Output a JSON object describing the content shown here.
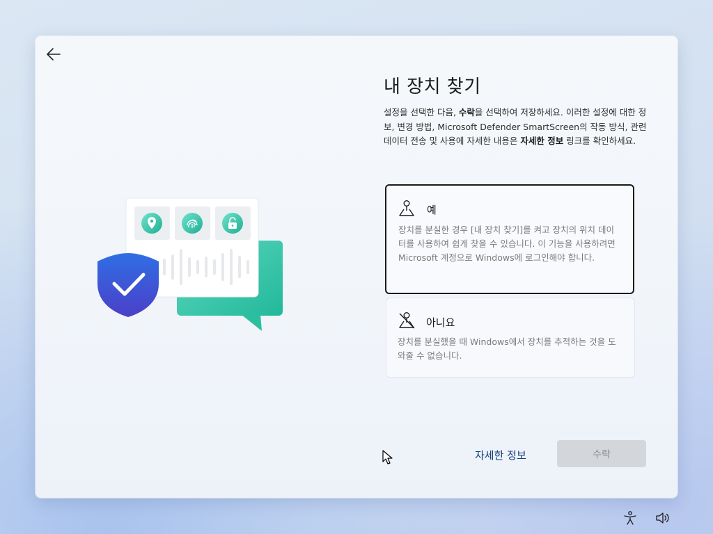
{
  "page": {
    "title": "내 장치 찾기",
    "description": {
      "part1": "설정을 선택한 다음, ",
      "accept_word": "수락",
      "part2": "을 선택하여 저장하세요. 이러한 설정에 대한 정보, 변경 방법, Microsoft Defender SmartScreen의 작동 방식, 관련 데이터 전송 및 사용에 자세한 내용은 ",
      "learn_more_word": "자세한 정보",
      "part3": " 링크를 확인하세요."
    }
  },
  "options": [
    {
      "label": "예",
      "text": "장치를 분실한 경우 [내 장치 찾기]를 켜고 장치의 위치 데이터를 사용하여 쉽게 찾을 수 있습니다. 이 기능을 사용하려면 Microsoft 계정으로 Windows에 로그인해야 합니다.",
      "icon": "location-on-icon",
      "selected": true
    },
    {
      "label": "아니요",
      "text": "장치를 분실했을 때 Windows에서 장치를 추적하는 것을 도와줄 수 없습니다.",
      "icon": "location-off-icon",
      "selected": false
    }
  ],
  "footer": {
    "learn_more_label": "자세한 정보",
    "accept_label": "수락",
    "accept_enabled": false
  },
  "colors": {
    "shield": "#3b5bdb",
    "bubble": "#34c9a9",
    "accept_disabled_bg": "#d3d6da",
    "link": "#123e7a"
  },
  "icons": {
    "back": "back-arrow-icon",
    "tray": [
      "accessibility-icon",
      "volume-icon"
    ]
  }
}
